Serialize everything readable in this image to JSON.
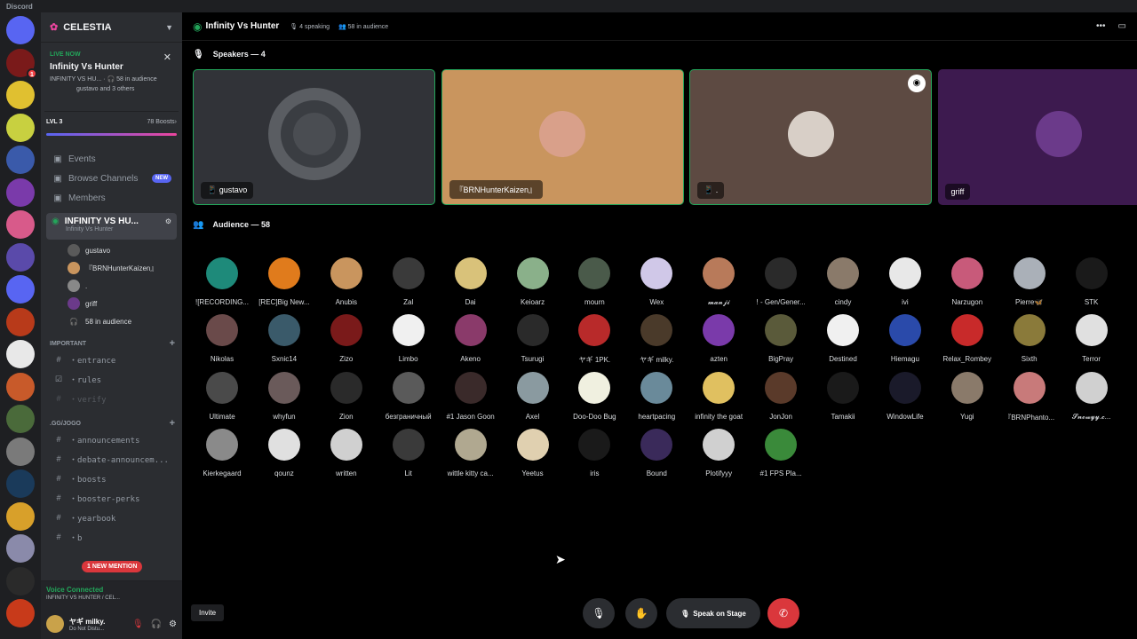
{
  "app_title": "Discord",
  "guild_badge": "1",
  "server": {
    "name": "CELESTIA"
  },
  "live": {
    "now": "LIVE NOW",
    "title": "Infinity Vs Hunter",
    "sub1": "INFINITY VS HU...",
    "audience": "58 in audience",
    "sub2": "gustavo and 3 others"
  },
  "boost": {
    "level": "LVL 3",
    "count": "78 Boosts"
  },
  "nav": [
    {
      "label": "Events",
      "icon": "calendar-icon"
    },
    {
      "label": "Browse Channels",
      "icon": "browse-icon",
      "badge": "NEW"
    },
    {
      "label": "Members",
      "icon": "members-icon"
    }
  ],
  "stage_channel": {
    "name": "INFINITY VS HU...",
    "sub": "Infinity Vs Hunter"
  },
  "stage_members": [
    {
      "name": "gustavo",
      "color": "#5a5a5a"
    },
    {
      "name": "『BRNHunterKaizen』",
      "color": "#c9955e"
    },
    {
      "name": ".",
      "color": "#888"
    },
    {
      "name": "griff",
      "color": "#6b3a8a"
    }
  ],
  "stage_audience": "58 in audience",
  "categories": [
    {
      "name": "IMPORTANT",
      "channels": [
        "・entrance",
        "・rules",
        "・verify"
      ]
    },
    {
      "name": ".GG/JOGO",
      "channels": [
        "・announcements",
        "・debate-announcem...",
        "・boosts",
        "・booster-perks",
        "・yearbook",
        "・b"
      ]
    }
  ],
  "mention_pill": "1 NEW MENTION",
  "voice": {
    "status": "Voice Connected",
    "channel": "INFINITY VS HUNTER / CEL..."
  },
  "user": {
    "name": "ヤギ milky.",
    "status": "Do Not Distu..."
  },
  "topbar": {
    "title": "Infinity Vs Hunter",
    "speaking": "4 speaking",
    "audience": "58 in audience"
  },
  "speakers_title": "Speakers — 4",
  "speakers": [
    {
      "name": "gustavo",
      "bg": "#313338",
      "av": "#4a4d52",
      "border": "#23a55a"
    },
    {
      "name": "『BRNHunterKaizen』",
      "bg": "#c9955e",
      "av": "#d9a08a",
      "border": "#23a55a"
    },
    {
      "name": ".",
      "bg": "#5d4a42",
      "av": "#d8cfc7",
      "border": "#23a55a"
    },
    {
      "name": "griff",
      "bg": "#3d1a4f",
      "av": "#6b3a8a",
      "border": "none"
    }
  ],
  "audience_title": "Audience — 58",
  "audience": [
    {
      "name": "![RECORDING...",
      "color": "#1e8a7a"
    },
    {
      "name": "[REC]Big New...",
      "color": "#e07b1c"
    },
    {
      "name": "Anubis",
      "color": "#c9955e"
    },
    {
      "name": "Zal",
      "color": "#3a3a3a"
    },
    {
      "name": "Dai",
      "color": "#d9c27a"
    },
    {
      "name": "Keioarz",
      "color": "#8ab08a"
    },
    {
      "name": "mourn",
      "color": "#4a5a4a"
    },
    {
      "name": "Wex",
      "color": "#d0c8e8"
    },
    {
      "name": "𝓶𝓪𝓷𝓳𝓲",
      "color": "#b87a5a"
    },
    {
      "name": "! - Gen/Gener...",
      "color": "#2a2a2a"
    },
    {
      "name": "cindy",
      "color": "#8a7a6a"
    },
    {
      "name": "ivi",
      "color": "#e8e8e8"
    },
    {
      "name": "Narzugon",
      "color": "#c85a7a"
    },
    {
      "name": "Pierre🦋",
      "color": "#aab0b8"
    },
    {
      "name": "STK",
      "color": "#1a1a1a"
    },
    {
      "name": "Nikolas",
      "color": "#6a4a4a"
    },
    {
      "name": "Sxnic14",
      "color": "#3a5a6a"
    },
    {
      "name": "Zizo",
      "color": "#7a1a1a"
    },
    {
      "name": "Limbo",
      "color": "#f0f0f0"
    },
    {
      "name": "Akeno",
      "color": "#8a3a6a"
    },
    {
      "name": "Tsurugi",
      "color": "#2a2a2a"
    },
    {
      "name": "ヤギ 1PK.",
      "color": "#b82a2a"
    },
    {
      "name": "ヤギ milky.",
      "color": "#4a3a2a"
    },
    {
      "name": "azten",
      "color": "#7a3aaa"
    },
    {
      "name": "BigPray",
      "color": "#5a5a3a"
    },
    {
      "name": "Destined",
      "color": "#f0f0f0"
    },
    {
      "name": "Hiemagu",
      "color": "#2a4aaa"
    },
    {
      "name": "Relax_Rombey",
      "color": "#c82a2a"
    },
    {
      "name": "Sixth",
      "color": "#8a7a3a"
    },
    {
      "name": "Terror",
      "color": "#e0e0e0"
    },
    {
      "name": "Ultimate",
      "color": "#4a4a4a"
    },
    {
      "name": "whyfun",
      "color": "#6a5a5a"
    },
    {
      "name": "Zion",
      "color": "#2a2a2a"
    },
    {
      "name": "безграничный",
      "color": "#5a5a5a"
    },
    {
      "name": "#1 Jason Goon",
      "color": "#3a2a2a"
    },
    {
      "name": "Axel",
      "color": "#8a9aa0"
    },
    {
      "name": "Doo-Doo Bug",
      "color": "#f0f0e0"
    },
    {
      "name": "heartpacing",
      "color": "#6a8a9a"
    },
    {
      "name": "infinity the goat",
      "color": "#e0c060"
    },
    {
      "name": "JonJon",
      "color": "#5a3a2a"
    },
    {
      "name": "Tamakii",
      "color": "#1a1a1a"
    },
    {
      "name": "WindowLife",
      "color": "#1a1a2a"
    },
    {
      "name": "Yugi",
      "color": "#8a7a6a"
    },
    {
      "name": "『BRNPhanto...",
      "color": "#c87a7a"
    },
    {
      "name": "𝓢𝓷𝓸𝔀𝔂𝔂.𝓬...",
      "color": "#d0d0d0"
    },
    {
      "name": "Kierkegaard",
      "color": "#8a8a8a"
    },
    {
      "name": "qounz",
      "color": "#e0e0e0"
    },
    {
      "name": "written",
      "color": "#d0d0d0"
    },
    {
      "name": "Lit",
      "color": "#3a3a3a"
    },
    {
      "name": "wittle kitty ca...",
      "color": "#b0a890"
    },
    {
      "name": "Yeetus",
      "color": "#e0d0b0"
    },
    {
      "name": "iris",
      "color": "#1a1a1a"
    },
    {
      "name": "Bound",
      "color": "#3a2a5a"
    },
    {
      "name": "Plotifyyy",
      "color": "#d0d0d0"
    },
    {
      "name": "#1 FPS Pla...",
      "color": "#3a8a3a"
    }
  ],
  "invite_label": "Invite",
  "speak_label": "Speak on Stage"
}
